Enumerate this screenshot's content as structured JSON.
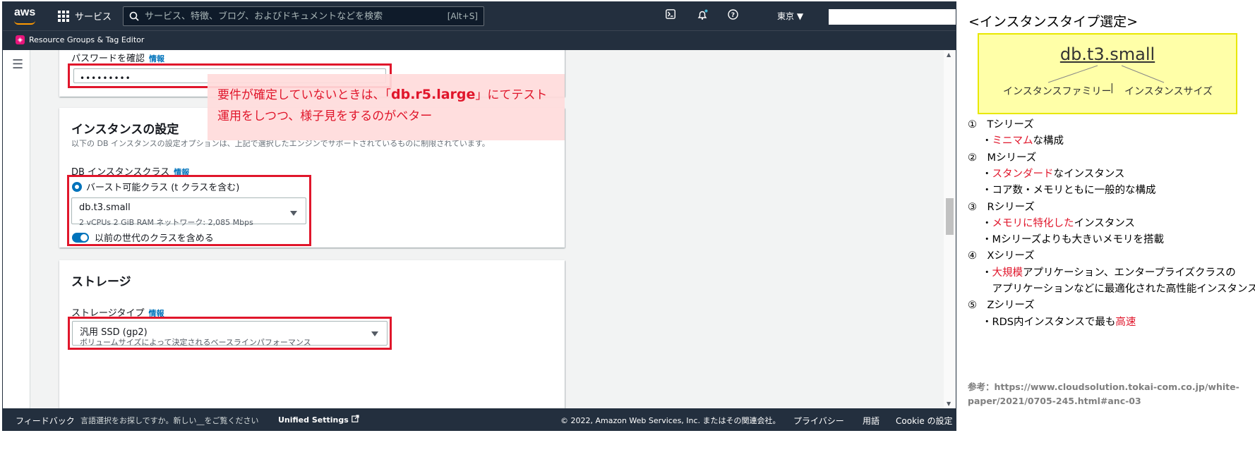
{
  "topnav": {
    "logo": "aws",
    "services_label": "サービス",
    "search_placeholder": "サービス、特徴、ブログ、およびドキュメントなどを検索",
    "search_shortcut": "[Alt+S]",
    "region": "東京 ▼",
    "icons": [
      "cloudshell-icon",
      "bell-icon",
      "help-icon"
    ]
  },
  "subnav": {
    "resource_groups": "Resource Groups & Tag Editor"
  },
  "password": {
    "label": "パスワードを確認",
    "info": "情報",
    "value": "•••••••••"
  },
  "instance": {
    "title": "インスタンスの設定",
    "description": "以下の DB インスタンスの設定オプションは、上記で選択したエンジンでサポートされているものに制限されています。",
    "class_label": "DB インスタンスクラス",
    "info": "情報",
    "radio_label": "バースト可能クラス (t クラスを含む)",
    "select_main": "db.t3.small",
    "select_sub": "2 vCPUs     2 GiB RAM     ネットワーク: 2,085 Mbps",
    "toggle_label": "以前の世代のクラスを含める"
  },
  "callout": {
    "before": "要件が確定していないときは、「",
    "emphasis": "db.r5.large",
    "after": "」にてテスト運用をしつつ、様子見をするのがベター"
  },
  "storage": {
    "title": "ストレージ",
    "type_label": "ストレージタイプ",
    "info": "情報",
    "select_main": "汎用 SSD (gp2)",
    "select_sub": "ボリュームサイズによって決定されるベースラインパフォーマンス"
  },
  "footer": {
    "feedback": "フィードバック",
    "language_prompt": "言語選択をお探しですか。新しい__をご覧ください",
    "unified_settings": "Unified Settings",
    "copyright": "© 2022, Amazon Web Services, Inc. またはその関連会社。",
    "privacy": "プライバシー",
    "terms": "用語",
    "cookie": "Cookie の設定"
  },
  "notes": {
    "title": "<インスタンスタイプ選定>",
    "diagram_main": "db.t3.small",
    "family": "インスタンスファミリー",
    "separator": "|",
    "size": "インスタンスサイズ",
    "series": [
      {
        "head": "①　Tシリーズ",
        "lines": [
          {
            "pre": "・",
            "red": "ミニマム",
            "post": "な構成"
          }
        ]
      },
      {
        "head": "②　Mシリーズ",
        "lines": [
          {
            "pre": "・",
            "red": "スタンダード",
            "post": "なインスタンス"
          },
          {
            "pre": "・コア数・メモリともに一般的な構成",
            "red": "",
            "post": ""
          }
        ]
      },
      {
        "head": "③　Rシリーズ",
        "lines": [
          {
            "pre": "・",
            "red": "メモリに特化した",
            "post": "インスタンス"
          },
          {
            "pre": "・Mシリーズよりも大きいメモリを搭載",
            "red": "",
            "post": ""
          }
        ]
      },
      {
        "head": "④　Xシリーズ",
        "lines": [
          {
            "pre": "・",
            "red": "大規模",
            "post": "アプリケーション、エンタープライズクラスの"
          },
          {
            "pre": "　アプリケーションなどに最適化された高性能インスタンス",
            "red": "",
            "post": ""
          }
        ]
      },
      {
        "head": "⑤　Zシリーズ",
        "lines": [
          {
            "pre": "・RDS内インスタンスで最も",
            "red": "高速",
            "post": ""
          }
        ]
      }
    ],
    "reference": "参考：https://www.cloudsolution.tokai-com.co.jp/white-paper/2021/0705-245.html#anc-03"
  },
  "colors": {
    "nav": "#232f3e",
    "accent": "#0073bb",
    "highlight": "#e0162b",
    "note_box": "#ffffa8"
  }
}
